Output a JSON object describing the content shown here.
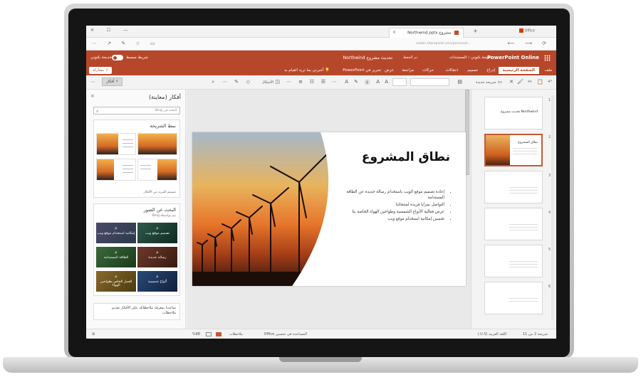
{
  "browser": {
    "tab_title": "مشروع Northwind.pptx",
    "office_tab": "Office",
    "url": "eaabc.sharepoint.com/personal/..."
  },
  "ppt": {
    "app_name": "PowerPoint Online",
    "breadcrumb": "خديجة بلتوني  ›  المستندات",
    "doc_title": "تحديث مشروع Northwind",
    "saved": "تم الحفظ",
    "simplified": "شريط مبسط",
    "user": "خديجة بلتوني",
    "share": "مشاركة",
    "tabs": [
      "ملف",
      "الصفحة الرئيسية",
      "إدراج",
      "تصميم",
      "انتقالات",
      "حركات",
      "مراجعة",
      "عرض",
      "تحرير في PowerPoint"
    ],
    "tell_me": "أخبرني بما تريد القيام به",
    "new_slide": "شريحة جديدة",
    "shapes": "الأشكال",
    "ideas": "أفكار"
  },
  "designer": {
    "title": "أفكار (معاينة)",
    "search_placeholder": "البحث في Bing",
    "layouts_title": "نمط الشريحة",
    "layouts_link": "تصميم المزيد من الأفكار",
    "images_title": "البحث عن الصور",
    "images_sub": "يتم بواسطة Bing",
    "tiles": [
      "تصميم موقع ويب",
      "إمكانية استخدام موقع ويب",
      "رسالة جديدة",
      "الطاقة المستدامة",
      "ألواح شمسية",
      "العمل الخاص بطواحين الهواء"
    ],
    "feedback": "ساعدنا بمعرفة ملاحظاتك على الأفكار تقديم ملاحظات"
  },
  "slide": {
    "title": "نطاق المشروع",
    "bullets": [
      "إعادة تصميم موقع الويب باستخدام رسالة جديدة عن الطاقة المستدامة",
      "التواصل بمزايا فريدة لمنتجاتنا",
      "عرض فعالية الأنواع الشمسية وطواحين الهواء الخاصة بنا",
      "تحسين إمكانية استخدام موقع ويب"
    ]
  },
  "thumbnails": {
    "numbers": [
      "1",
      "2",
      "3",
      "4",
      "5",
      "6"
    ],
    "t1_title": "تحديث مشروع Northwind",
    "t2_title": "نطاق المشروع"
  },
  "status": {
    "slide_pos": "شريحة 2 من 11",
    "language": "اللغة العربية (U.S.)",
    "help": "المساعدة في تحسين Office",
    "notes": "ملاحظات",
    "zoom": "%88"
  }
}
